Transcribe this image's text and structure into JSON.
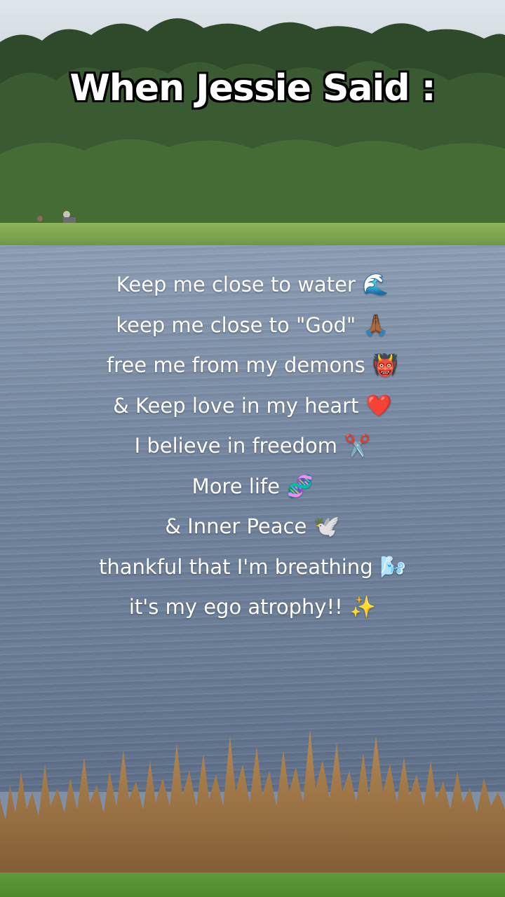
{
  "title": "When Jessie Said :",
  "lines": [
    {
      "text": "Keep me close to water",
      "emoji": "🌊"
    },
    {
      "text": "keep me close to \"God\"",
      "emoji": "🙏🏾"
    },
    {
      "text": "free me from my demons",
      "emoji": "👹"
    },
    {
      "text": "& Keep love in my heart",
      "emoji": "❤️"
    },
    {
      "text": "I believe in freedom",
      "emoji": "✂️"
    },
    {
      "text": "More life",
      "emoji": "🧬"
    },
    {
      "text": "& Inner Peace",
      "emoji": "🕊️"
    },
    {
      "text": "thankful that I'm breathing",
      "emoji": "🌬️"
    },
    {
      "text": "it's my ego atrophy!!",
      "emoji": "✨"
    }
  ]
}
